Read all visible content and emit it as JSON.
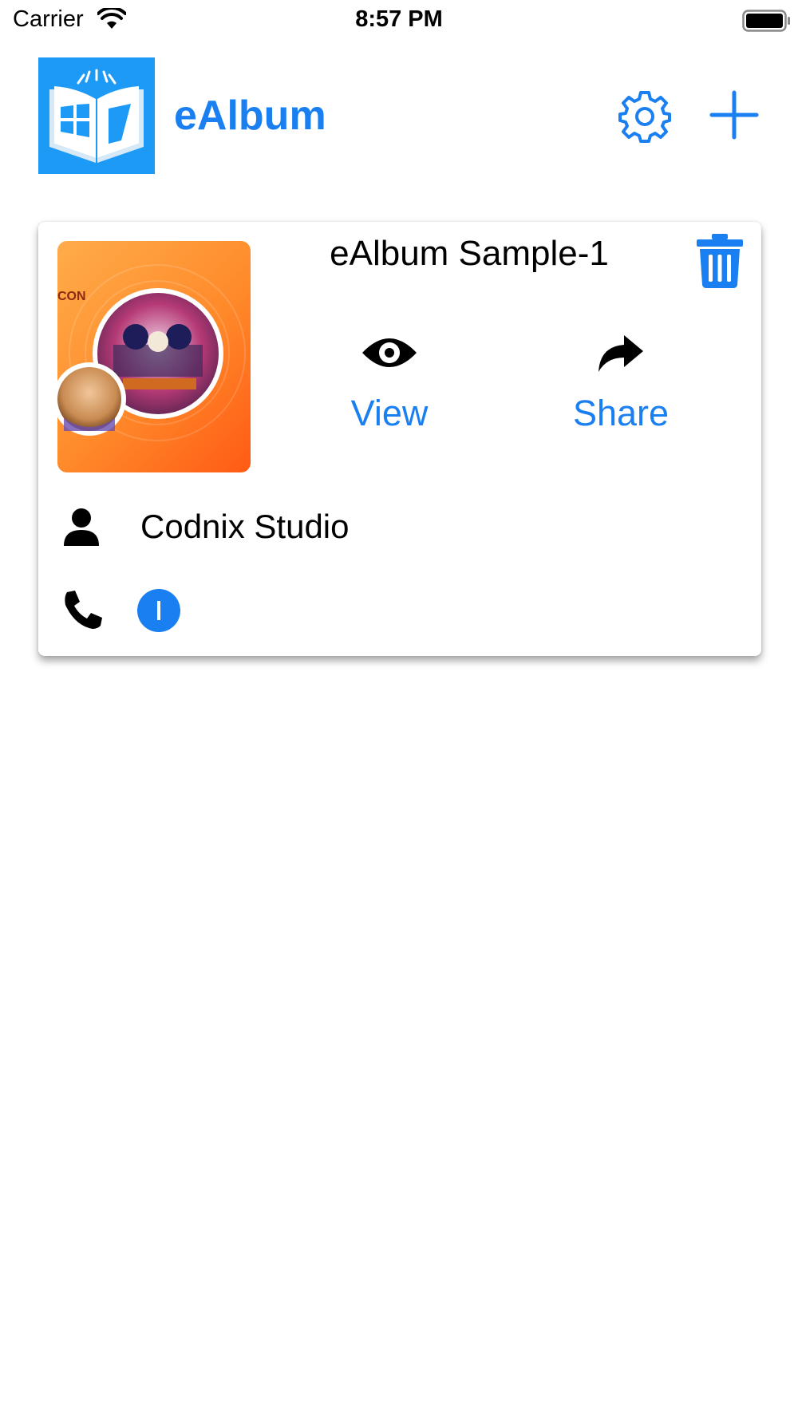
{
  "status_bar": {
    "carrier": "Carrier",
    "time": "8:57 PM"
  },
  "header": {
    "app_title": "eAlbum",
    "logo_icon": "open-book-icon",
    "settings_icon": "gear-icon",
    "add_icon": "plus-icon"
  },
  "album_card": {
    "title": "eAlbum Sample-1",
    "delete_icon": "trash-icon",
    "view_label": "View",
    "view_icon": "eye-icon",
    "share_label": "Share",
    "share_icon": "share-arrow-icon",
    "owner_icon": "person-icon",
    "owner_name": "Codnix Studio",
    "phone_icon": "phone-icon",
    "info_icon": "info-icon",
    "thumbnail_text": "CON"
  },
  "colors": {
    "accent": "#1a7ff0",
    "logo_background": "#1c9af6",
    "thumbnail_orange": "#ff8a2a"
  }
}
